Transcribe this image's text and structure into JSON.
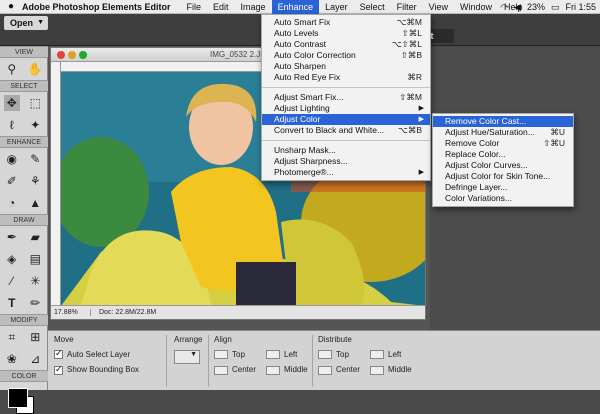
{
  "menubar": {
    "apple": "",
    "app_name": "Adobe Photoshop Elements Editor",
    "items": [
      "File",
      "Edit",
      "Image",
      "Enhance",
      "Layer",
      "Select",
      "Filter",
      "View",
      "Window",
      "Help"
    ],
    "active": "Enhance",
    "status": {
      "battery": "23%",
      "time": "Fri 1:55"
    }
  },
  "toolbar": {
    "open_label": "Open",
    "start_label": "rt"
  },
  "toolbox": {
    "sections": [
      "VIEW",
      "SELECT",
      "ENHANCE",
      "DRAW",
      "MODIFY",
      "COLOR"
    ]
  },
  "document": {
    "title": "IMG_0532 2.JPG @ 17",
    "zoom": "17.88%",
    "doc_size": "Doc: 22.8M/22.8M"
  },
  "options": {
    "move_title": "Move",
    "auto_select": "Auto Select Layer",
    "bounding_box": "Show Bounding Box",
    "arrange_title": "Arrange",
    "align_title": "Align",
    "align_top": "Top",
    "align_center": "Center",
    "align_left": "Left",
    "align_middle": "Middle",
    "distribute_title": "Distribute",
    "dist_top": "Top",
    "dist_center": "Center",
    "dist_left": "Left",
    "dist_middle": "Middle"
  },
  "enhance_menu": {
    "items": [
      {
        "label": "Auto Smart Fix",
        "shortcut": "⌥⌘M"
      },
      {
        "label": "Auto Levels",
        "shortcut": "⇧⌘L"
      },
      {
        "label": "Auto Contrast",
        "shortcut": "⌥⇧⌘L"
      },
      {
        "label": "Auto Color Correction",
        "shortcut": "⇧⌘B"
      },
      {
        "label": "Auto Sharpen",
        "shortcut": ""
      },
      {
        "label": "Auto Red Eye Fix",
        "shortcut": "⌘R"
      },
      {
        "label": "Adjust Smart Fix...",
        "shortcut": "⇧⌘M"
      },
      {
        "label": "Adjust Lighting",
        "shortcut": "▶"
      },
      {
        "label": "Adjust Color",
        "shortcut": "▶"
      },
      {
        "label": "Convert to Black and White...",
        "shortcut": "⌥⌘B"
      },
      {
        "label": "Unsharp Mask...",
        "shortcut": ""
      },
      {
        "label": "Adjust Sharpness...",
        "shortcut": ""
      },
      {
        "label": "Photomerge®...",
        "shortcut": "▶"
      }
    ]
  },
  "adjust_color_menu": {
    "items": [
      {
        "label": "Remove Color Cast...",
        "shortcut": ""
      },
      {
        "label": "Adjust Hue/Saturation...",
        "shortcut": "⌘U"
      },
      {
        "label": "Remove Color",
        "shortcut": "⇧⌘U"
      },
      {
        "label": "Replace Color...",
        "shortcut": ""
      },
      {
        "label": "Adjust Color Curves...",
        "shortcut": ""
      },
      {
        "label": "Adjust Color for Skin Tone...",
        "shortcut": ""
      },
      {
        "label": "Defringe Layer...",
        "shortcut": ""
      },
      {
        "label": "Color Variations...",
        "shortcut": ""
      }
    ]
  },
  "colors": {
    "menu_highlight": "#2a63d6",
    "app_bar": "#3e3e3e"
  }
}
